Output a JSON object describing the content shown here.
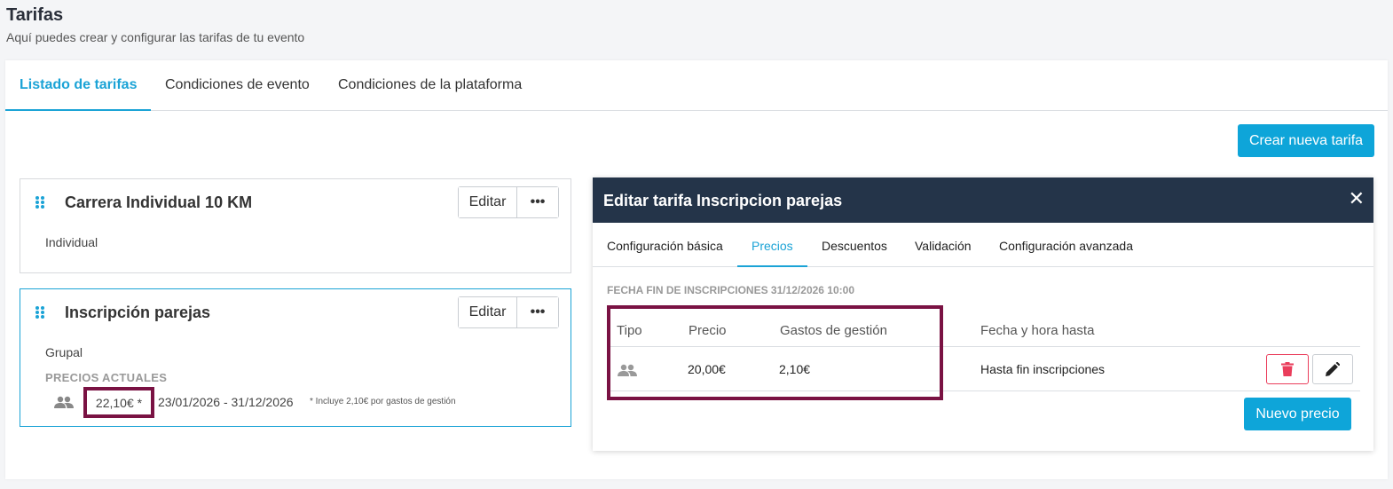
{
  "page": {
    "title": "Tarifas",
    "subtitle": "Aquí puedes crear y configurar las tarifas de tu evento"
  },
  "tabs": [
    {
      "label": "Listado de tarifas",
      "active": true
    },
    {
      "label": "Condiciones de evento",
      "active": false
    },
    {
      "label": "Condiciones de la plataforma",
      "active": false
    }
  ],
  "create_button": "Crear nueva tarifa",
  "tarifas": [
    {
      "name": "Carrera Individual 10 KM",
      "type": "Individual",
      "edit_label": "Editar",
      "more_label": "•••"
    },
    {
      "name": "Inscripción parejas",
      "type": "Grupal",
      "edit_label": "Editar",
      "more_label": "•••",
      "prices_label": "PRECIOS ACTUALES",
      "price": "22,10€ *",
      "dates": "23/01/2026 - 31/12/2026",
      "note": "* Incluye 2,10€ por gastos de gestión"
    }
  ],
  "edit_panel": {
    "title": "Editar tarifa Inscripcion parejas",
    "close": "✕",
    "tabs": [
      {
        "label": "Configuración básica",
        "active": false
      },
      {
        "label": "Precios",
        "active": true
      },
      {
        "label": "Descuentos",
        "active": false
      },
      {
        "label": "Validación",
        "active": false
      },
      {
        "label": "Configuración avanzada",
        "active": false
      }
    ],
    "fecha_fin": "FECHA FIN DE INSCRIPCIONES 31/12/2026 10:00",
    "table": {
      "headers": [
        "Tipo",
        "Precio",
        "Gastos de gestión",
        "Fecha y hora hasta"
      ],
      "rows": [
        {
          "tipo_icon": "group-icon",
          "precio": "20,00€",
          "gastos": "2,10€",
          "fecha": "Hasta fin inscripciones"
        }
      ]
    },
    "new_price_button": "Nuevo precio"
  },
  "colors": {
    "accent": "#1ba3d6",
    "button": "#0ea5d9",
    "panel_header": "#243449",
    "highlight": "#7a1243",
    "delete": "#ea3d5b"
  }
}
